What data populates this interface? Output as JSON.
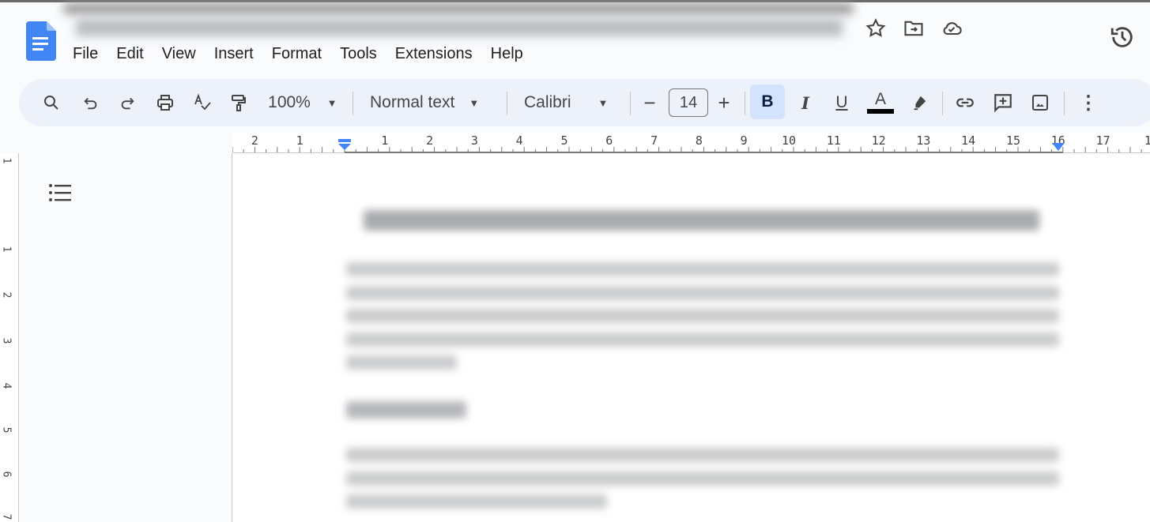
{
  "menu": [
    "File",
    "Edit",
    "View",
    "Insert",
    "Format",
    "Tools",
    "Extensions",
    "Help"
  ],
  "toolbar": {
    "zoom": "100%",
    "style": "Normal text",
    "font": "Calibri",
    "font_size": "14",
    "bold_active": true,
    "text_color": "#000000"
  },
  "ruler": {
    "left": [
      "2",
      "1"
    ],
    "main": [
      "1",
      "2",
      "3",
      "4",
      "5",
      "6",
      "7",
      "8",
      "9",
      "10",
      "11",
      "12",
      "13",
      "14",
      "15",
      "16",
      "17",
      "1"
    ]
  },
  "vruler": [
    "1",
    "1",
    "2",
    "3",
    "4",
    "5",
    "6",
    "7"
  ],
  "colors": {
    "accent": "#4285f4",
    "bold_bg": "#d3e3fd"
  }
}
